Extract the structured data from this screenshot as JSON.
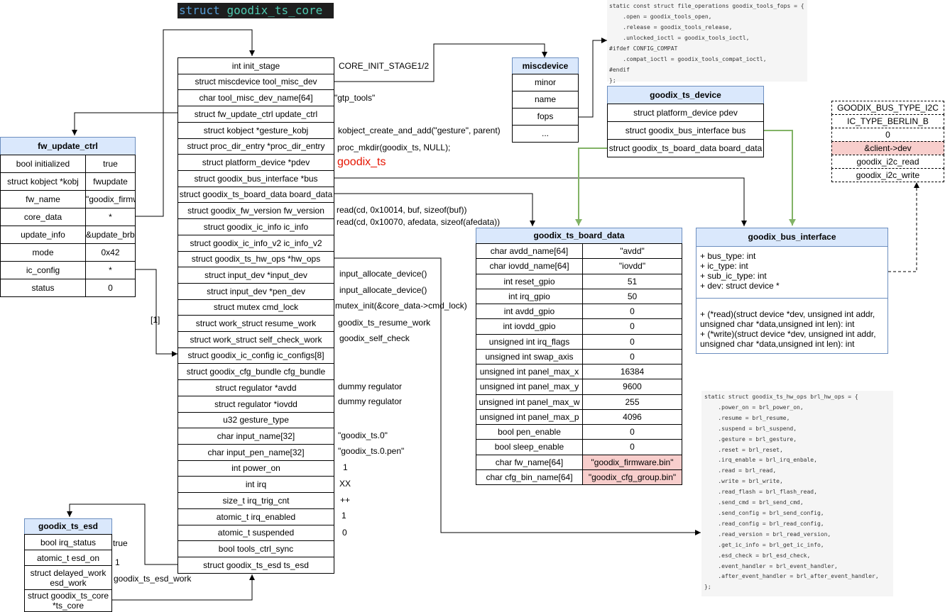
{
  "title": {
    "keyword": "struct",
    "name": "goodix_ts_core"
  },
  "core_fields": [
    "int init_stage",
    "struct miscdevice tool_misc_dev",
    "char tool_misc_dev_name[64]",
    "struct fw_update_ctrl update_ctrl",
    "struct kobject *gesture_kobj",
    "struct proc_dir_entry *proc_dir_entry",
    "struct platform_device *pdev",
    "struct goodix_bus_interface *bus",
    "struct goodix_ts_board_data board_data",
    "struct goodix_fw_version fw_version",
    "struct goodix_ic_info ic_info",
    "struct goodix_ic_info_v2 ic_info_v2",
    "struct goodix_ts_hw_ops *hw_ops",
    "struct input_dev *input_dev",
    "struct input_dev *pen_dev",
    "struct mutex cmd_lock",
    "struct work_struct resume_work",
    "struct work_struct self_check_work",
    "struct goodix_ic_config ic_configs[8]",
    "struct goodix_cfg_bundle cfg_bundle",
    "struct regulator *avdd",
    "struct regulator *iovdd",
    "u32 gesture_type",
    "char input_name[32]",
    "char input_pen_name[32]",
    "int power_on",
    "int irq",
    "size_t irq_trig_cnt",
    "atomic_t irq_enabled",
    "atomic_t suspended",
    "bool tools_ctrl_sync",
    "struct goodix_ts_esd ts_esd"
  ],
  "core_notes": {
    "init_stage": "CORE_INIT_STAGE1/2",
    "tool_misc_dev_name": "\"gtp_tools\"",
    "gesture_kobj": "kobject_create_and_add(\"gesture\", parent)",
    "proc_dir_entry": "proc_mkdir(goodix_ts, NULL);",
    "pdev": "goodix_ts",
    "fw_version": "read(cd, 0x10014, buf, sizeof(buf))",
    "ic_info": "read(cd, 0x10070, afedata, sizeof(afedata))",
    "input_dev": "input_allocate_device()",
    "pen_dev": "input_allocate_device()",
    "cmd_lock": "mutex_init(&core_data->cmd_lock)",
    "resume_work": "goodix_ts_resume_work",
    "self_check_work": "goodix_self_check",
    "avdd": "dummy regulator",
    "iovdd": "dummy regulator",
    "input_name": "\"goodix_ts.0\"",
    "input_pen_name": "\"goodix_ts.0.pen\"",
    "power_on": "1",
    "irq": "XX",
    "irq_trig_cnt": "++",
    "irq_enabled": "1",
    "suspended": "0",
    "esd_work": "goodix_ts_esd_work"
  },
  "fw_update_ctrl": {
    "title": "fw_update_ctrl",
    "rows": [
      [
        "bool initialized",
        "true"
      ],
      [
        "struct kobject *kobj",
        "fwupdate"
      ],
      [
        "fw_name",
        "\"goodix_firmw"
      ],
      [
        "core_data",
        "*"
      ],
      [
        "update_info",
        "&update_brb"
      ],
      [
        "mode",
        "0x42"
      ],
      [
        "ic_config",
        "*"
      ],
      [
        "status",
        "0"
      ]
    ],
    "link_label": "[1]"
  },
  "goodix_ts_esd": {
    "title": "goodix_ts_esd",
    "rows": [
      "bool irq_status",
      "atomic_t esd_on",
      "struct delayed_work esd_work",
      "struct goodix_ts_core *ts_core"
    ],
    "values": [
      "true",
      "1"
    ]
  },
  "miscdevice": {
    "title": "miscdevice",
    "rows": [
      "minor",
      "name",
      "fops",
      "..."
    ]
  },
  "fops_code": "static const struct file_operations goodix_tools_fops = {\n\t.open = goodix_tools_open,\n\t.release = goodix_tools_release,\n\t.unlocked_ioctl = goodix_tools_ioctl,\n#ifdef CONFIG_COMPAT\n\t.compat_ioctl = goodix_tools_compat_ioctl,\n#endif\n};",
  "goodix_ts_device": {
    "title": "goodix_ts_device",
    "rows": [
      "struct platform_device pdev",
      "struct goodix_bus_interface bus",
      "struct goodix_ts_board_data board_data"
    ]
  },
  "i2c_box": {
    "rows": [
      "GOODIX_BUS_TYPE_I2C",
      "IC_TYPE_BERLIN_B",
      "0",
      "&client->dev",
      "goodix_i2c_read",
      "goodix_i2c_write"
    ]
  },
  "board_data": {
    "title": "goodix_ts_board_data",
    "rows": [
      [
        "char avdd_name[64]",
        "\"avdd\""
      ],
      [
        "char iovdd_name[64]",
        "\"iovdd\""
      ],
      [
        "int reset_gpio",
        "51"
      ],
      [
        "int irq_gpio",
        "50"
      ],
      [
        "int avdd_gpio",
        "0"
      ],
      [
        "int iovdd_gpio",
        "0"
      ],
      [
        "unsigned int irq_flags",
        "0"
      ],
      [
        "unsigned int swap_axis",
        "0"
      ],
      [
        "unsigned int panel_max_x",
        "16384"
      ],
      [
        "unsigned int panel_max_y",
        "9600"
      ],
      [
        "unsigned int panel_max_w",
        "255"
      ],
      [
        "unsigned int panel_max_p",
        "4096"
      ],
      [
        "bool pen_enable",
        "0"
      ],
      [
        "bool sleep_enable",
        "0"
      ],
      [
        "char fw_name[64]",
        "\"goodix_firmware.bin\""
      ],
      [
        "char cfg_bin_name[64]",
        "\"goodix_cfg_group.bin\""
      ]
    ]
  },
  "bus_interface": {
    "title": "goodix_bus_interface",
    "attrs": [
      "+ bus_type: int",
      "+ ic_type: int",
      "+ sub_ic_type: int",
      "+ dev: struct device *"
    ],
    "methods": [
      "+ (*read)(struct device *dev, unsigned int addr,",
      "unsigned char *data,unsigned int len): int",
      "+ (*write)(struct device *dev, unsigned int addr,",
      "unsigned char *data,unsigned int len): int"
    ]
  },
  "hw_ops_code": "static struct goodix_ts_hw_ops brl_hw_ops = {\n\t.power_on = brl_power_on,\n\t.resume = brl_resume,\n\t.suspend = brl_suspend,\n\t.gesture = brl_gesture,\n\t.reset = brl_reset,\n\t.irq_enable = brl_irq_enbale,\n\t.read = brl_read,\n\t.write = brl_write,\n\t.read_flash = brl_flash_read,\n\t.send_cmd = brl_send_cmd,\n\t.send_config = brl_send_config,\n\t.read_config = brl_read_config,\n\t.read_version = brl_read_version,\n\t.get_ic_info = brl_get_ic_info,\n\t.esd_check = brl_esd_check,\n\t.event_handler = brl_event_handler,\n\t.after_event_handler = brl_after_event_handler,\n};",
  "colors": {
    "header": "#dae8fc",
    "pink": "#f8cecc",
    "green_arrow": "#82b366",
    "pdev_note": "#e51400"
  }
}
